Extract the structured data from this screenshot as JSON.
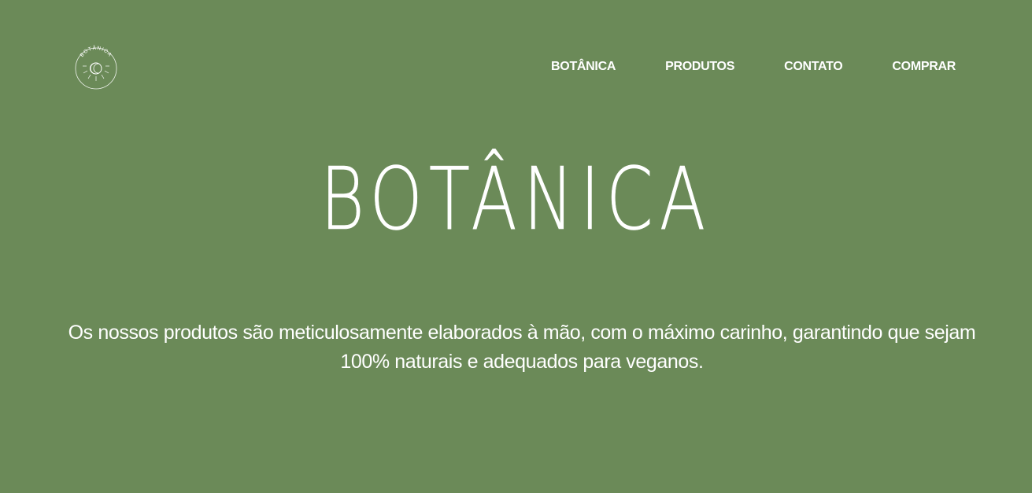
{
  "brand": {
    "logo_text": "BOTÂNICA",
    "logo_icon": "sun-moon-icon"
  },
  "nav": {
    "items": [
      {
        "label": "BOTÂNICA"
      },
      {
        "label": "PRODUTOS"
      },
      {
        "label": "CONTATO"
      },
      {
        "label": "COMPRAR"
      }
    ]
  },
  "hero": {
    "title": "BOTÂNICA",
    "description": "Os nossos produtos são meticulosamente elaborados à mão, com o máximo carinho, garantindo que sejam 100% naturais e adequados para veganos."
  },
  "colors": {
    "background": "#6b8a58",
    "text": "#ffffff"
  }
}
